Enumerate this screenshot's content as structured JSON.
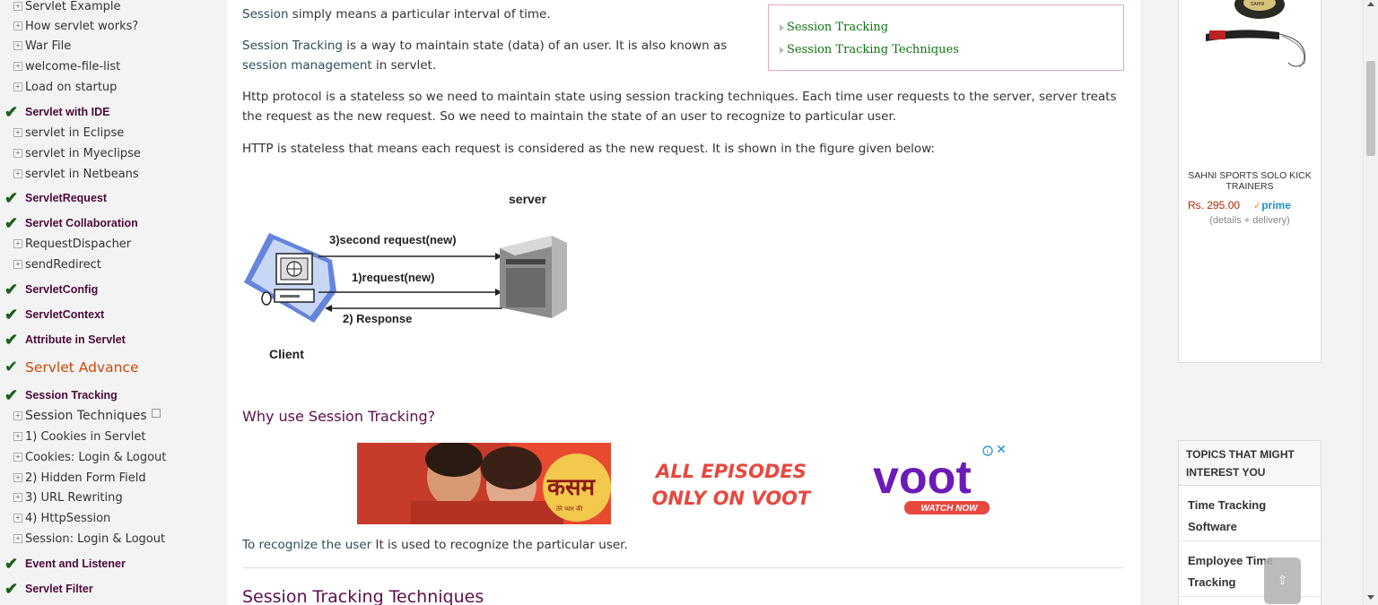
{
  "sidebar": {
    "items": [
      {
        "label": "Servlet Example",
        "kind": "sub"
      },
      {
        "label": "How servlet works?",
        "kind": "sub"
      },
      {
        "label": "War File",
        "kind": "sub"
      },
      {
        "label": "welcome-file-list",
        "kind": "sub"
      },
      {
        "label": "Load on startup",
        "kind": "sub"
      },
      {
        "label": "Servlet with IDE",
        "kind": "head"
      },
      {
        "label": "servlet in Eclipse",
        "kind": "sub"
      },
      {
        "label": "servlet in Myeclipse",
        "kind": "sub"
      },
      {
        "label": "servlet in Netbeans",
        "kind": "sub"
      },
      {
        "label": "ServletRequest",
        "kind": "head"
      },
      {
        "label": "Servlet Collaboration",
        "kind": "head"
      },
      {
        "label": "RequestDispacher",
        "kind": "sub"
      },
      {
        "label": "sendRedirect",
        "kind": "sub"
      },
      {
        "label": "ServletConfig",
        "kind": "head"
      },
      {
        "label": "ServletContext",
        "kind": "head"
      },
      {
        "label": "Attribute in Servlet",
        "kind": "head"
      },
      {
        "label": "Servlet Advance",
        "kind": "adv"
      },
      {
        "label": "Session Tracking",
        "kind": "head"
      },
      {
        "label": "Session Techniques",
        "kind": "current"
      },
      {
        "label": "1) Cookies in Servlet",
        "kind": "sub"
      },
      {
        "label": "Cookies: Login & Logout",
        "kind": "sub"
      },
      {
        "label": "2) Hidden Form Field",
        "kind": "sub"
      },
      {
        "label": "3) URL Rewriting",
        "kind": "sub"
      },
      {
        "label": "4) HttpSession",
        "kind": "sub"
      },
      {
        "label": "Session: Login & Logout",
        "kind": "sub"
      },
      {
        "label": "Event and Listener",
        "kind": "head"
      },
      {
        "label": "Servlet Filter",
        "kind": "head"
      }
    ]
  },
  "main": {
    "p1_kw": "Session",
    "p1_rest": " simply means a particular interval of time.",
    "p2_kw1": "Session Tracking",
    "p2_mid": " is a way to maintain state (data) of an user. It is also known as",
    "p2_kw2": "session management",
    "p2_rest": " in servlet.",
    "p3_line1": "Http protocol is a stateless so we need to maintain state using session tracking techniques. Each time user requests to the server, server treats",
    "p3_line2": "the request as the new request. So we need to maintain the state of an user to recognize to particular user.",
    "p4": "HTTP is stateless that means each request is considered as the new request. It is shown in the figure given below:",
    "toc": [
      "Session Tracking",
      "Session Tracking Techniques"
    ],
    "figure": {
      "server_label": "server",
      "client_label": "Client",
      "arrow3": "3)second request(new)",
      "arrow1": "1)request(new)",
      "arrow2": "2) Response"
    },
    "why_heading": "Why use Session Tracking?",
    "ad": {
      "show_text": "कसम",
      "show_sub": "तेरे प्यार की",
      "tagline_line1": "ALL EPISODES",
      "tagline_line2": "ONLY ON VOOT",
      "brand": "voot",
      "cta": "WATCH NOW"
    },
    "recognize_kw": "To recognize the user",
    "recognize_rest": " It is used to recognize the particular user.",
    "techniques_heading": "Session Tracking Techniques"
  },
  "right": {
    "product_brand": "SAHNI",
    "product_name": "SAHNI SPORTS SOLO KICK TRAINERS",
    "product_price": "Rs. 295.00",
    "prime_label": "prime",
    "details": "(details + delivery)",
    "topics_heading": "TOPICS THAT MIGHT INTEREST YOU",
    "topics": [
      "Time Tracking Software",
      "Employee Time Tracking"
    ]
  },
  "scroll_top_label": "⇧",
  "colors": {
    "heading": "#5d0f4d",
    "check": "#1a5e1a",
    "advance": "#d14805",
    "toc_link": "#107310",
    "voot_purple": "#6c1bb8",
    "price": "#b12704"
  }
}
